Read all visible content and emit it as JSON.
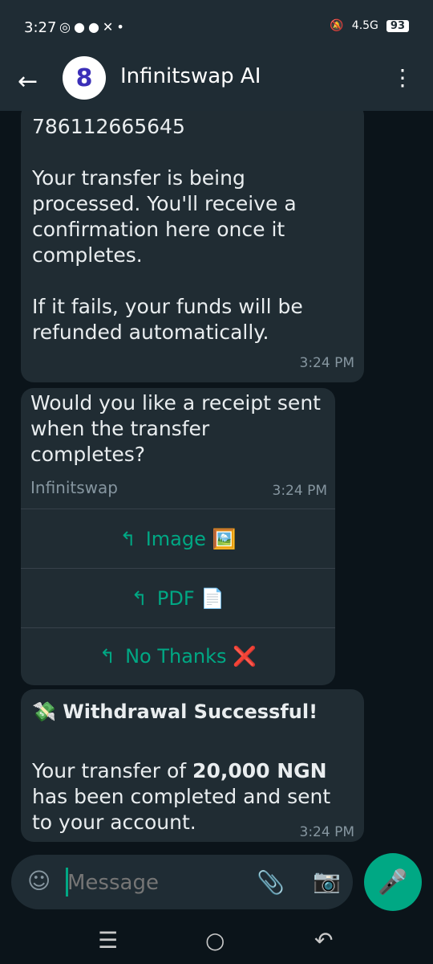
{
  "status": {
    "time": "3:27",
    "left_icons": [
      "whatsapp-icon",
      "facebook-icon",
      "chat-icon",
      "x-icon",
      "dot-icon"
    ],
    "network": "4.5G",
    "battery": "93"
  },
  "header": {
    "title": "Infinitswap AI",
    "avatar_glyph": "8"
  },
  "messages": [
    {
      "text": "786112665645\n\nYour transfer is being processed. You'll receive a confirmation here once it completes.\n\nIf it fails, your funds will be refunded automatically.",
      "time": "3:24 PM"
    },
    {
      "text": "Would you like a receipt sent when the transfer completes?",
      "footer": "Infinitswap",
      "time": "3:24 PM",
      "quick_replies": [
        "Image 🖼️",
        "PDF 📄",
        "No Thanks ❌"
      ]
    },
    {
      "heading": "💸 Withdrawal Successful!",
      "text_prefix": "Your transfer of ",
      "amount": "20,000 NGN",
      "text_suffix": " has been completed and sent to your account.",
      "time": "3:24 PM"
    }
  ],
  "composer": {
    "placeholder": "Message"
  },
  "colors": {
    "accent": "#00a884",
    "bubble": "#202c33",
    "background": "#0b141a"
  }
}
